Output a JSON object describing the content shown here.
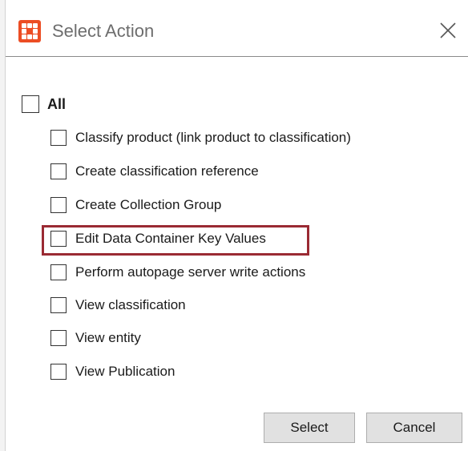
{
  "window": {
    "title": "Select Action",
    "icon": "app-logo-icon",
    "close_icon": "close-icon"
  },
  "options": {
    "all_label": "All",
    "items": [
      {
        "label": "Classify product (link product to classification)",
        "checked": false
      },
      {
        "label": "Create classification reference",
        "checked": false
      },
      {
        "label": "Create Collection Group",
        "checked": false
      },
      {
        "label": "Edit Data Container Key Values",
        "checked": false,
        "highlighted": true
      },
      {
        "label": "Perform autopage server write actions",
        "checked": false
      },
      {
        "label": "View classification",
        "checked": false
      },
      {
        "label": "View entity",
        "checked": false
      },
      {
        "label": "View Publication",
        "checked": false
      }
    ]
  },
  "buttons": {
    "select_label": "Select",
    "cancel_label": "Cancel"
  },
  "colors": {
    "brand_icon": "#ec4d24",
    "highlight_border": "#9a2a33"
  }
}
